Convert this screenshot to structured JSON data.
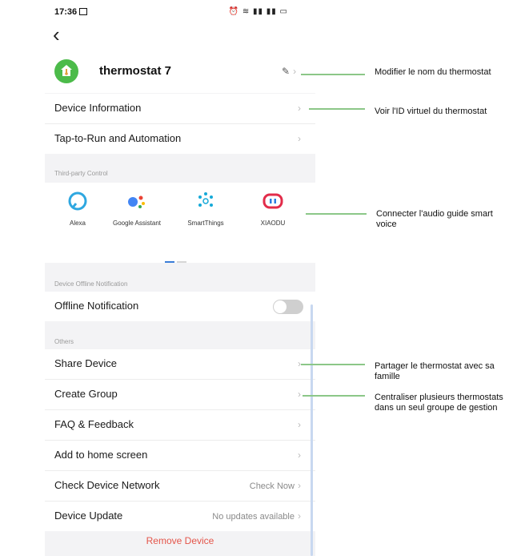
{
  "status": {
    "time": "17:36",
    "icons": "⏰ ≋ ▮▮ ▮▮ ▭"
  },
  "device": {
    "name": "thermostat 7"
  },
  "menu": {
    "device_information": "Device Information",
    "tap_to_run": "Tap-to-Run and Automation",
    "third_party_label": "Third-party Control",
    "offline_section": "Device Offline Notification",
    "offline_notification": "Offline Notification",
    "offline_enabled": false,
    "others_label": "Others",
    "share_device": "Share Device",
    "create_group": "Create Group",
    "faq": "FAQ & Feedback",
    "add_home": "Add to home screen",
    "check_network": "Check Device Network",
    "check_now": "Check Now",
    "device_update": "Device Update",
    "no_updates": "No updates available",
    "remove_device": "Remove Device"
  },
  "third_party": [
    {
      "name": "Alexa"
    },
    {
      "name": "Google Assistant"
    },
    {
      "name": "SmartThings"
    },
    {
      "name": "XIAODU"
    }
  ],
  "annotations": {
    "rename": "Modifier le nom du thermostat",
    "virtual_id": "Voir l'ID virtuel du thermostat",
    "audio_guide": "Connecter l'audio guide smart voice",
    "share": "Partager le thermostat avec sa famille",
    "group": "Centraliser plusieurs thermostats dans un seul groupe de gestion"
  },
  "colors": {
    "accent_green": "#4cbb4a",
    "annotation_line": "#8cc788",
    "remove_red": "#e4554a",
    "page_indicator": "#3b7dd8"
  }
}
